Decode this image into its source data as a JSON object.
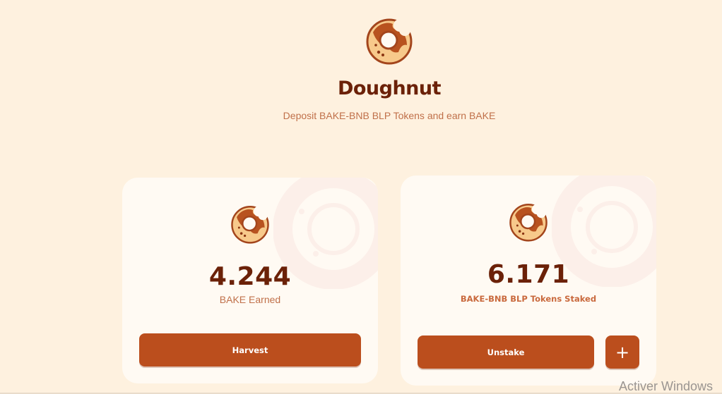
{
  "header": {
    "title": "Doughnut",
    "subtitle": "Deposit BAKE-BNB BLP Tokens and earn BAKE",
    "logo_icon": "doughnut-icon"
  },
  "earned_card": {
    "value": "4.244",
    "label": "BAKE Earned",
    "button_label": "Harvest",
    "icon": "doughnut-icon"
  },
  "staked_card": {
    "value": "6.171",
    "label": "BAKE-BNB BLP Tokens Staked",
    "unstake_label": "Unstake",
    "add_label": "+",
    "icon": "doughnut-icon"
  },
  "system": {
    "watermark": "Activer Windows"
  },
  "colors": {
    "background": "#fef1df",
    "card": "#fffaf3",
    "accent": "#bb4e1d",
    "title": "#6b2108",
    "muted": "#c0704a"
  }
}
